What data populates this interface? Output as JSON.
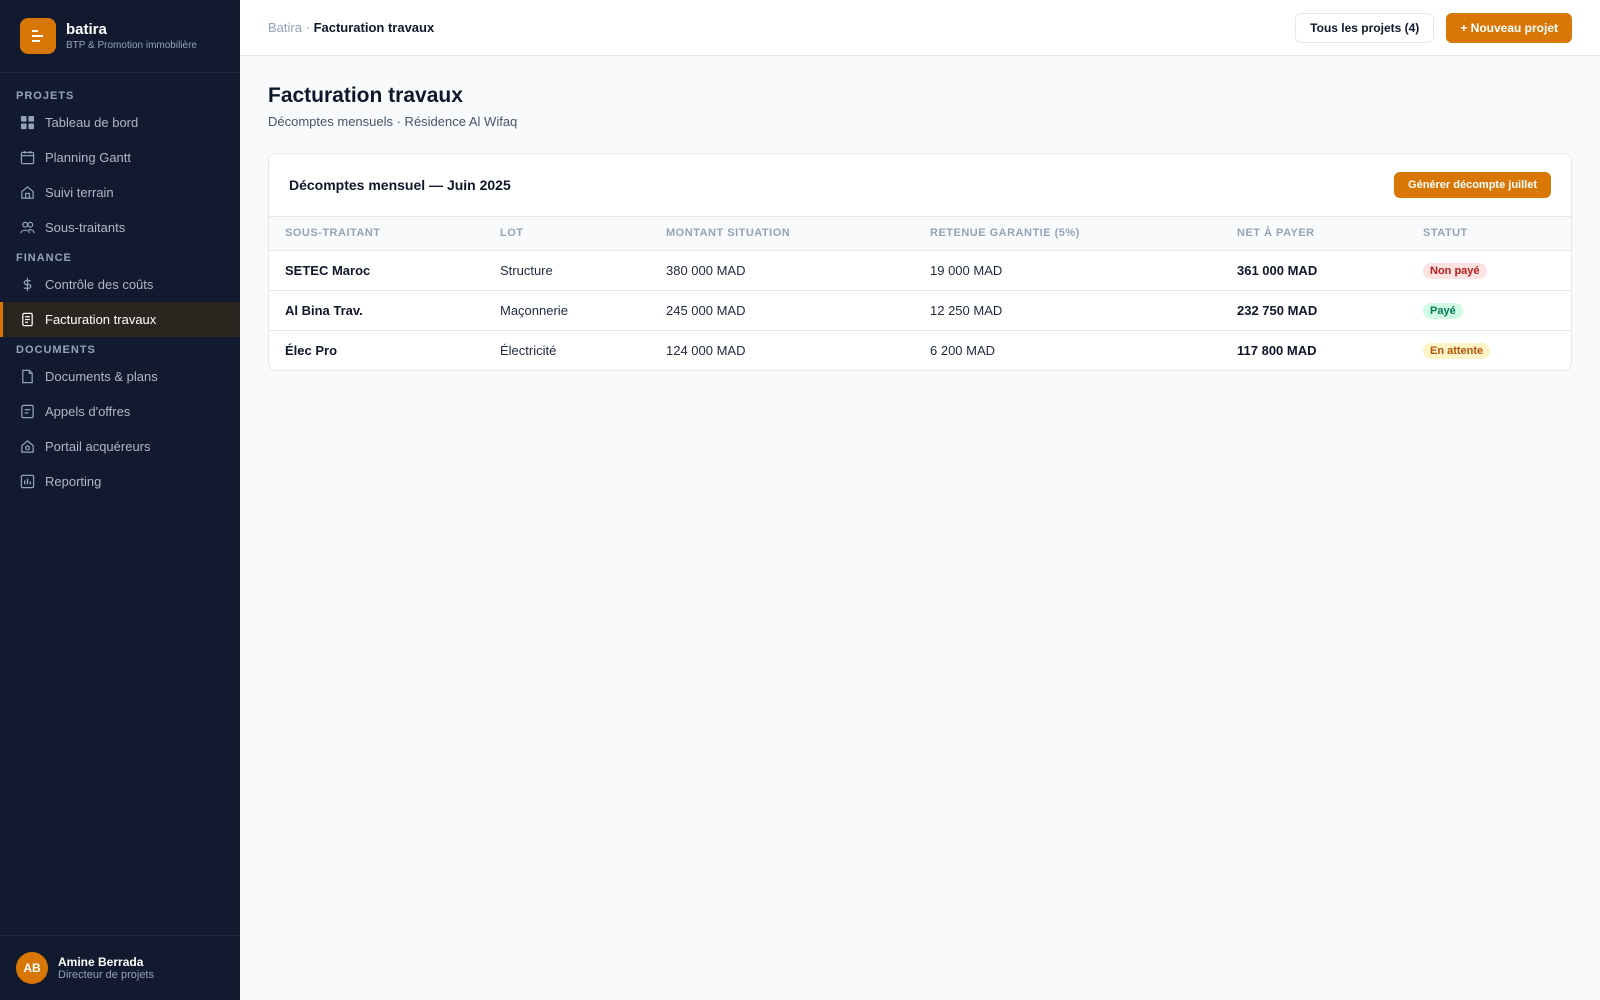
{
  "brand": {
    "name": "batira",
    "subtitle": "BTP & Promotion immobilière"
  },
  "sidebar": {
    "sections": [
      {
        "label": "PROJETS",
        "items": [
          {
            "label": "Tableau de bord",
            "icon": "grid-icon"
          },
          {
            "label": "Planning Gantt",
            "icon": "calendar-icon"
          },
          {
            "label": "Suivi terrain",
            "icon": "home-icon"
          },
          {
            "label": "Sous-traitants",
            "icon": "users-icon"
          }
        ]
      },
      {
        "label": "FINANCE",
        "items": [
          {
            "label": "Contrôle des coûts",
            "icon": "dollar-icon"
          },
          {
            "label": "Facturation travaux",
            "icon": "invoice-icon",
            "active": true
          }
        ]
      },
      {
        "label": "DOCUMENTS",
        "items": [
          {
            "label": "Documents & plans",
            "icon": "file-icon"
          },
          {
            "label": "Appels d'offres",
            "icon": "document-icon"
          },
          {
            "label": "Portail acquéreurs",
            "icon": "house-icon"
          },
          {
            "label": "Reporting",
            "icon": "chart-icon"
          }
        ]
      }
    ]
  },
  "user": {
    "initials": "AB",
    "name": "Amine Berrada",
    "role": "Directeur de projets"
  },
  "topbar": {
    "breadcrumb_root": "Batira",
    "breadcrumb_sep": "·",
    "breadcrumb_current": "Facturation travaux",
    "all_projects_label": "Tous les projets (4)",
    "new_project_label": "+ Nouveau projet"
  },
  "page": {
    "title": "Facturation travaux",
    "subtitle": "Décomptes mensuels · Résidence Al Wifaq"
  },
  "card": {
    "title": "Décomptes mensuel — Juin 2025",
    "action_label": "Générer décompte juillet",
    "columns": [
      "SOUS-TRAITANT",
      "LOT",
      "MONTANT SITUATION",
      "RETENUE GARANTIE (5%)",
      "NET À PAYER",
      "STATUT"
    ],
    "rows": [
      {
        "subcontractor": "SETEC Maroc",
        "lot": "Structure",
        "amount": "380 000 MAD",
        "retention": "19 000 MAD",
        "net": "361 000 MAD",
        "status": "Non payé",
        "status_color": "#b91c1c"
      },
      {
        "subcontractor": "Al Bina Trav.",
        "lot": "Maçonnerie",
        "amount": "245 000 MAD",
        "retention": "12 250 MAD",
        "net": "232 750 MAD",
        "status": "Payé",
        "status_color": "#047857"
      },
      {
        "subcontractor": "Élec Pro",
        "lot": "Électricité",
        "amount": "124 000 MAD",
        "retention": "6 200 MAD",
        "net": "117 800 MAD",
        "status": "En attente",
        "status_color": "#b45309"
      }
    ]
  },
  "colors": {
    "accent": "#d97706",
    "sidebar_bg": "#111a2e"
  }
}
